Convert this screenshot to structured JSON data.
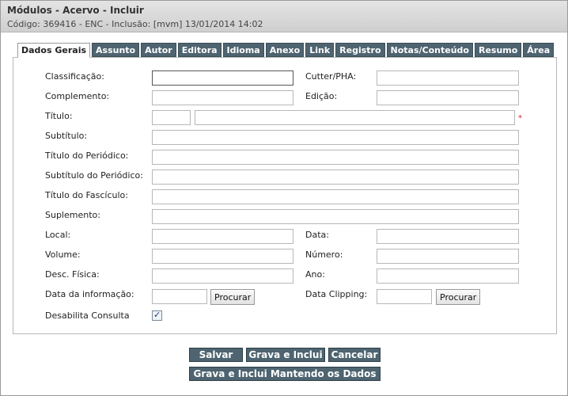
{
  "header": {
    "title": "Módulos - Acervo - Incluir",
    "subtitle": "Código: 369416 - ENC - Inclusão: [mvm] 13/01/2014 14:02"
  },
  "tabs": [
    {
      "label": "Dados Gerais",
      "active": true
    },
    {
      "label": "Assunto"
    },
    {
      "label": "Autor"
    },
    {
      "label": "Editora"
    },
    {
      "label": "Idioma"
    },
    {
      "label": "Anexo"
    },
    {
      "label": "Link"
    },
    {
      "label": "Registro"
    },
    {
      "label": "Notas/Conteúdo"
    },
    {
      "label": "Resumo"
    },
    {
      "label": "Área"
    }
  ],
  "form": {
    "classificacao": {
      "label": "Classificação:",
      "value": ""
    },
    "cutter": {
      "label": "Cutter/PHA:",
      "value": ""
    },
    "complemento": {
      "label": "Complemento:",
      "value": ""
    },
    "edicao": {
      "label": "Edição:",
      "value": ""
    },
    "titulo": {
      "label": "Título:",
      "value_a": "",
      "value_b": "",
      "required_mark": "*"
    },
    "subtitulo": {
      "label": "Subtítulo:",
      "value": ""
    },
    "titulo_periodico": {
      "label": "Título do Periódico:",
      "value": ""
    },
    "subtitulo_periodico": {
      "label": "Subtítulo do Periódico:",
      "value": ""
    },
    "titulo_fasciculo": {
      "label": "Título do Fascículo:",
      "value": ""
    },
    "suplemento": {
      "label": "Suplemento:",
      "value": ""
    },
    "local": {
      "label": "Local:",
      "value": ""
    },
    "data": {
      "label": "Data:",
      "value": ""
    },
    "volume": {
      "label": "Volume:",
      "value": ""
    },
    "numero": {
      "label": "Número:",
      "value": ""
    },
    "desc_fisica": {
      "label": "Desc. Física:",
      "value": ""
    },
    "ano": {
      "label": "Ano:",
      "value": ""
    },
    "data_informacao": {
      "label": "Data da informação:",
      "value": "",
      "button": "Procurar"
    },
    "data_clipping": {
      "label": "Data Clipping:",
      "value": "",
      "button": "Procurar"
    },
    "desabilita_consulta": {
      "label": "Desabilita Consulta",
      "checked": true
    }
  },
  "actions": {
    "salvar": "Salvar",
    "grava_inclui": "Grava e Inclui",
    "cancelar": "Cancelar",
    "grava_inclui_mantendo": "Grava e Inclui Mantendo os Dados"
  }
}
